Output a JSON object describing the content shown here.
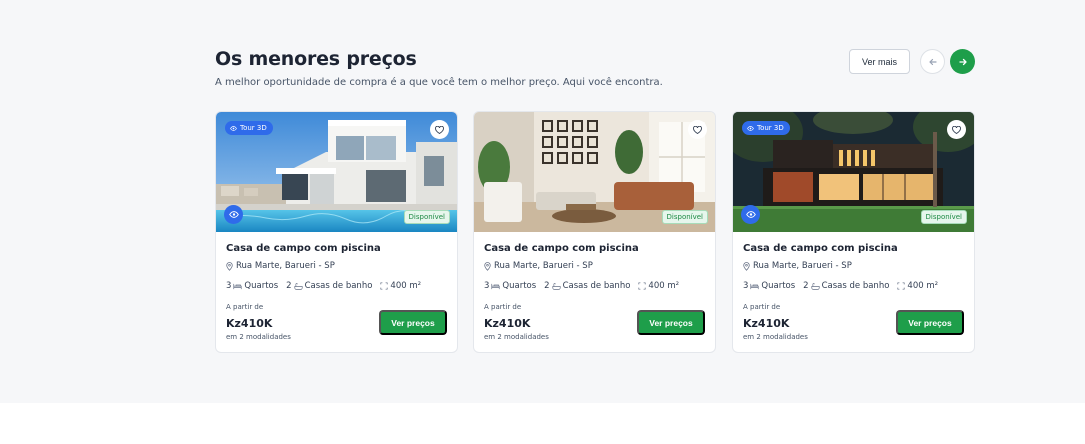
{
  "section": {
    "title": "Os menores preços",
    "subtitle": "A melhor oportunidade de compra é a que você tem o melhor preço. Aqui você encontra.",
    "see_more_label": "Ver mais"
  },
  "colors": {
    "brand_green": "#1e9e4a",
    "tour_blue": "#2f6bea"
  },
  "cards": [
    {
      "has_tour": true,
      "tour_label": "Tour 3D",
      "status": "Disponível",
      "title": "Casa de campo com piscina",
      "address": "Rua Marte, Barueri - SP",
      "rooms": "3",
      "rooms_label": "Quartos",
      "baths": "2",
      "baths_label": "Casas de banho",
      "area": "400 m²",
      "price_from": "A partir de",
      "price": "Kz410K",
      "modalities": "em 2 modalidades",
      "cta": "Ver preços"
    },
    {
      "has_tour": false,
      "status": "Disponível",
      "title": "Casa de campo com piscina",
      "address": "Rua Marte, Barueri - SP",
      "rooms": "3",
      "rooms_label": "Quartos",
      "baths": "2",
      "baths_label": "Casas de banho",
      "area": "400 m²",
      "price_from": "A partir de",
      "price": "Kz410K",
      "modalities": "em 2 modalidades",
      "cta": "Ver preços"
    },
    {
      "has_tour": true,
      "tour_label": "Tour 3D",
      "status": "Disponível",
      "title": "Casa de campo com piscina",
      "address": "Rua Marte, Barueri - SP",
      "rooms": "3",
      "rooms_label": "Quartos",
      "baths": "2",
      "baths_label": "Casas de banho",
      "area": "400 m²",
      "price_from": "A partir de",
      "price": "Kz410K",
      "modalities": "em 2 modalidades",
      "cta": "Ver preços"
    }
  ]
}
